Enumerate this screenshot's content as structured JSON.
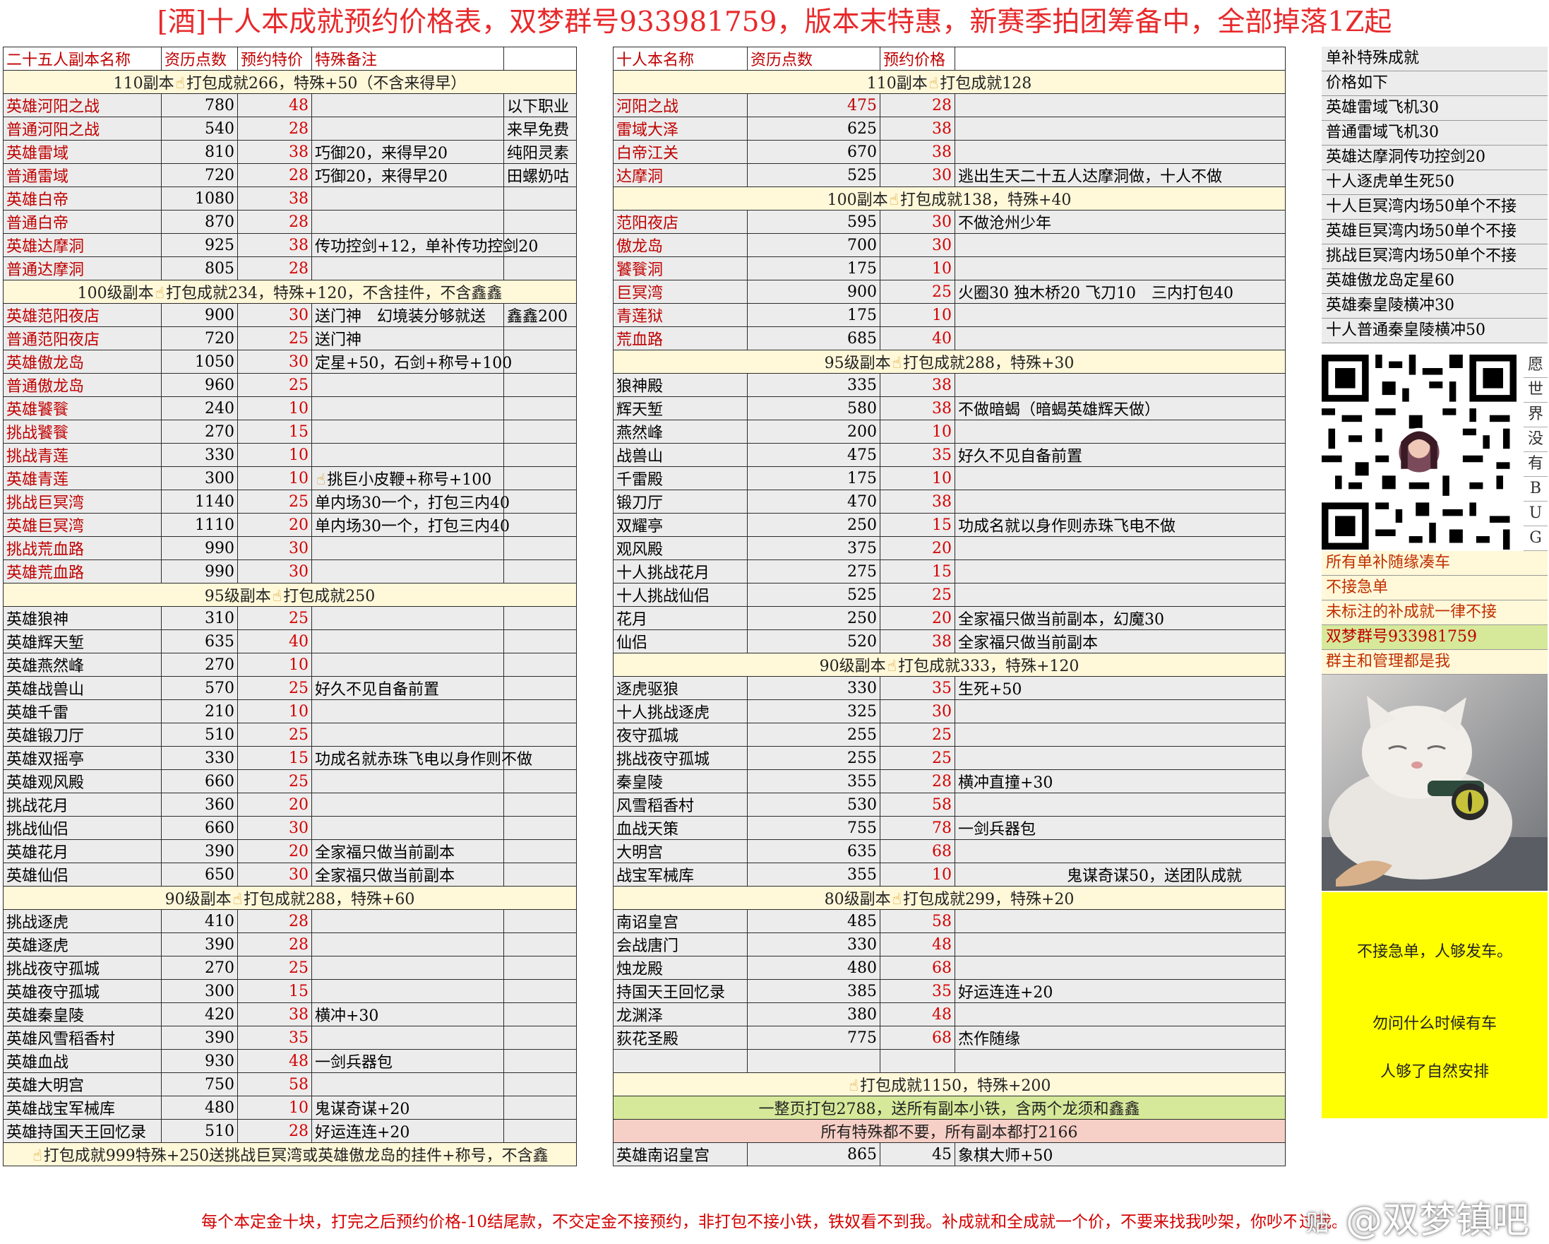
{
  "title": "[酒]十人本成就预约价格表，双梦群号933981759，版本末特惠，新赛季拍团筹备中，全部掉落1Z起",
  "footer": "每个本定金十块，打完之后预约价格-10结尾款，不交定金不接预约，非打包不接小铁，铁奴看不到我。补成就和全成就一个价，不要来找我吵架，你吵不过我。",
  "watermark": "@双梦镇吧",
  "left": {
    "headers": [
      "二十五人副本名称",
      "资历点数",
      "预约特价",
      "特殊备注",
      ""
    ],
    "rows": [
      {
        "type": "sec",
        "text": "110副本👆打包成就266，特殊+50（不含来得早）"
      },
      {
        "name": "英雄河阳之战",
        "pts": "780",
        "price": "48",
        "note": "",
        "extra": "以下职业",
        "red": true
      },
      {
        "name": "普通河阳之战",
        "pts": "540",
        "price": "28",
        "note": "",
        "extra": "来早免费",
        "red": true
      },
      {
        "name": "英雄雷域",
        "pts": "810",
        "price": "38",
        "note": "巧御20，来得早20",
        "extra": "纯阳灵素",
        "red": true
      },
      {
        "name": "普通雷域",
        "pts": "720",
        "price": "28",
        "note": "巧御20，来得早20",
        "extra": "田螺奶咕",
        "red": true
      },
      {
        "name": "英雄白帝",
        "pts": "1080",
        "price": "38",
        "note": "",
        "extra": "",
        "red": true
      },
      {
        "name": "普通白帝",
        "pts": "870",
        "price": "28",
        "note": "",
        "extra": "",
        "red": true
      },
      {
        "name": "英雄达摩洞",
        "pts": "925",
        "price": "38",
        "note": "传功控剑+12，单补传功控剑20",
        "extra": "",
        "red": true
      },
      {
        "name": "普通达摩洞",
        "pts": "805",
        "price": "28",
        "note": "",
        "extra": "",
        "red": true
      },
      {
        "type": "sec",
        "text": "100级副本👆打包成就234，特殊+120，不含挂件，不含鑫鑫"
      },
      {
        "name": "英雄范阳夜店",
        "pts": "900",
        "price": "30",
        "note": "送门神　幻境装分够就送",
        "extra": "鑫鑫200",
        "red": true
      },
      {
        "name": "普通范阳夜店",
        "pts": "720",
        "price": "25",
        "note": "送门神",
        "extra": "",
        "red": true
      },
      {
        "name": "英雄傲龙岛",
        "pts": "1050",
        "price": "30",
        "note": "定星+50，石剑+称号+100",
        "extra": "",
        "red": true
      },
      {
        "name": "普通傲龙岛",
        "pts": "960",
        "price": "25",
        "note": "",
        "extra": "",
        "red": true
      },
      {
        "name": "英雄饕餮",
        "pts": "240",
        "price": "10",
        "note": "",
        "extra": "",
        "red": true
      },
      {
        "name": "挑战饕餮",
        "pts": "270",
        "price": "15",
        "note": "",
        "extra": "",
        "red": true
      },
      {
        "name": "挑战青莲",
        "pts": "330",
        "price": "10",
        "note": "",
        "extra": "",
        "red": true
      },
      {
        "name": "英雄青莲",
        "pts": "300",
        "price": "10",
        "note": "👆挑巨小皮鞭+称号+100",
        "extra": "",
        "red": true
      },
      {
        "name": "挑战巨冥湾",
        "pts": "1140",
        "price": "25",
        "note": "单内场30一个，打包三内40",
        "extra": "",
        "red": true
      },
      {
        "name": "英雄巨冥湾",
        "pts": "1110",
        "price": "20",
        "note": "单内场30一个，打包三内40",
        "extra": "",
        "red": true
      },
      {
        "name": "挑战荒血路",
        "pts": "990",
        "price": "30",
        "note": "",
        "extra": "",
        "red": true
      },
      {
        "name": "英雄荒血路",
        "pts": "990",
        "price": "30",
        "note": "",
        "extra": "",
        "red": true
      },
      {
        "type": "sec",
        "text": "95级副本👆打包成就250"
      },
      {
        "name": "英雄狼神",
        "pts": "310",
        "price": "25",
        "note": "",
        "extra": ""
      },
      {
        "name": "英雄辉天堑",
        "pts": "635",
        "price": "40",
        "note": "",
        "extra": ""
      },
      {
        "name": "英雄燕然峰",
        "pts": "270",
        "price": "10",
        "note": "",
        "extra": ""
      },
      {
        "name": "英雄战兽山",
        "pts": "570",
        "price": "25",
        "note": "好久不见自备前置",
        "extra": ""
      },
      {
        "name": "英雄千雷",
        "pts": "210",
        "price": "10",
        "note": "",
        "extra": ""
      },
      {
        "name": "英雄锻刀厅",
        "pts": "510",
        "price": "25",
        "note": "",
        "extra": ""
      },
      {
        "name": "英雄双摇亭",
        "pts": "330",
        "price": "15",
        "note": "功成名就赤珠飞电以身作则不做",
        "extra": ""
      },
      {
        "name": "英雄观风殿",
        "pts": "660",
        "price": "25",
        "note": "",
        "extra": ""
      },
      {
        "name": "挑战花月",
        "pts": "360",
        "price": "20",
        "note": "",
        "extra": ""
      },
      {
        "name": "挑战仙侣",
        "pts": "660",
        "price": "30",
        "note": "",
        "extra": ""
      },
      {
        "name": "英雄花月",
        "pts": "390",
        "price": "20",
        "note": "全家福只做当前副本",
        "extra": ""
      },
      {
        "name": "英雄仙侣",
        "pts": "650",
        "price": "30",
        "note": "全家福只做当前副本",
        "extra": ""
      },
      {
        "type": "sec",
        "text": "90级副本👆打包成就288，特殊+60"
      },
      {
        "name": "挑战逐虎",
        "pts": "410",
        "price": "28",
        "note": "",
        "extra": ""
      },
      {
        "name": "英雄逐虎",
        "pts": "390",
        "price": "28",
        "note": "",
        "extra": ""
      },
      {
        "name": "挑战夜守孤城",
        "pts": "270",
        "price": "25",
        "note": "",
        "extra": ""
      },
      {
        "name": "英雄夜守孤城",
        "pts": "300",
        "price": "15",
        "note": "",
        "extra": ""
      },
      {
        "name": "英雄秦皇陵",
        "pts": "420",
        "price": "38",
        "note": "横冲+30",
        "extra": ""
      },
      {
        "name": "英雄风雪稻香村",
        "pts": "390",
        "price": "35",
        "note": "",
        "extra": ""
      },
      {
        "name": "英雄血战",
        "pts": "930",
        "price": "48",
        "note": "一剑兵器包",
        "extra": ""
      },
      {
        "name": "英雄大明宫",
        "pts": "750",
        "price": "58",
        "note": "",
        "extra": ""
      },
      {
        "name": "英雄战宝军械库",
        "pts": "480",
        "price": "10",
        "note": "鬼谋奇谋+20",
        "extra": ""
      },
      {
        "name": "英雄持国天王回忆录",
        "pts": "510",
        "price": "28",
        "note": "好运连连+20",
        "extra": ""
      },
      {
        "type": "sec",
        "text": "👆打包成就999特殊+250送挑战巨冥湾或英雄傲龙岛的挂件+称号，不含鑫"
      }
    ]
  },
  "middle": {
    "headers": [
      "十人本名称",
      "资历点数",
      "预约价格",
      "",
      ""
    ],
    "rows": [
      {
        "type": "sec",
        "text": "110副本👆打包成就128"
      },
      {
        "name": "河阳之战",
        "pts": "475",
        "price": "28",
        "note": "",
        "red": true,
        "redpts": true
      },
      {
        "name": "雷域大泽",
        "pts": "625",
        "price": "38",
        "note": "",
        "red": true
      },
      {
        "name": "白帝江关",
        "pts": "670",
        "price": "38",
        "note": "",
        "red": true
      },
      {
        "name": "达摩洞",
        "pts": "525",
        "price": "30",
        "note": "逃出生天二十五人达摩洞做，十人不做",
        "red": true
      },
      {
        "type": "sec",
        "text": "100副本👆打包成就138，特殊+40"
      },
      {
        "name": "范阳夜店",
        "pts": "595",
        "price": "30",
        "note": "不做沧州少年",
        "red": true
      },
      {
        "name": "傲龙岛",
        "pts": "700",
        "price": "30",
        "note": "",
        "red": true
      },
      {
        "name": "饕餮洞",
        "pts": "175",
        "price": "10",
        "note": "",
        "red": true
      },
      {
        "name": "巨冥湾",
        "pts": "900",
        "price": "25",
        "note": "火圈30 独木桥20 飞刀10　三内打包40",
        "red": true
      },
      {
        "name": "青莲狱",
        "pts": "175",
        "price": "10",
        "note": "",
        "red": true
      },
      {
        "name": "荒血路",
        "pts": "685",
        "price": "40",
        "note": "",
        "red": true
      },
      {
        "type": "sec",
        "text": "95级副本👆打包成就288，特殊+30"
      },
      {
        "name": "狼神殿",
        "pts": "335",
        "price": "38",
        "note": ""
      },
      {
        "name": "辉天堑",
        "pts": "580",
        "price": "38",
        "note": "不做暗蝎（暗蝎英雄辉天做）"
      },
      {
        "name": "燕然峰",
        "pts": "200",
        "price": "10",
        "note": ""
      },
      {
        "name": "战兽山",
        "pts": "475",
        "price": "35",
        "note": "好久不见自备前置"
      },
      {
        "name": "千雷殿",
        "pts": "175",
        "price": "10",
        "note": ""
      },
      {
        "name": "锻刀厅",
        "pts": "470",
        "price": "38",
        "note": ""
      },
      {
        "name": "双耀亭",
        "pts": "250",
        "price": "15",
        "note": "功成名就以身作则赤珠飞电不做"
      },
      {
        "name": "观风殿",
        "pts": "375",
        "price": "20",
        "note": ""
      },
      {
        "name": "十人挑战花月",
        "pts": "275",
        "price": "15",
        "note": ""
      },
      {
        "name": "十人挑战仙侣",
        "pts": "525",
        "price": "25",
        "note": ""
      },
      {
        "name": "花月",
        "pts": "250",
        "price": "20",
        "note": "全家福只做当前副本，幻魔30"
      },
      {
        "name": "仙侣",
        "pts": "520",
        "price": "38",
        "note": "全家福只做当前副本"
      },
      {
        "type": "sec",
        "text": "90级副本👆打包成就333，特殊+120"
      },
      {
        "name": "逐虎驱狼",
        "pts": "330",
        "price": "35",
        "note": "生死+50"
      },
      {
        "name": "十人挑战逐虎",
        "pts": "325",
        "price": "30",
        "note": ""
      },
      {
        "name": "夜守孤城",
        "pts": "255",
        "price": "25",
        "note": ""
      },
      {
        "name": "挑战夜守孤城",
        "pts": "255",
        "price": "25",
        "note": ""
      },
      {
        "name": "秦皇陵",
        "pts": "355",
        "price": "28",
        "note": "横冲直撞+30"
      },
      {
        "name": "风雪稻香村",
        "pts": "530",
        "price": "58",
        "note": ""
      },
      {
        "name": "血战天策",
        "pts": "755",
        "price": "78",
        "note": "一剑兵器包"
      },
      {
        "name": "大明宫",
        "pts": "635",
        "price": "68",
        "note": ""
      },
      {
        "name": "战宝军械库",
        "pts": "355",
        "price": "10",
        "note": "　　　　　　　鬼谋奇谋50，送团队成就"
      },
      {
        "type": "sec",
        "text": "80级副本👆打包成就299，特殊+20"
      },
      {
        "name": "南诏皇宫",
        "pts": "485",
        "price": "58",
        "note": ""
      },
      {
        "name": "会战唐门",
        "pts": "330",
        "price": "48",
        "note": ""
      },
      {
        "name": "烛龙殿",
        "pts": "480",
        "price": "68",
        "note": ""
      },
      {
        "name": "持国天王回忆录",
        "pts": "385",
        "price": "35",
        "note": "好运连连+20"
      },
      {
        "name": "龙渊泽",
        "pts": "380",
        "price": "48",
        "note": ""
      },
      {
        "name": "荻花圣殿",
        "pts": "775",
        "price": "68",
        "note": "杰作随缘"
      },
      {
        "name": "",
        "pts": "",
        "price": "",
        "note": ""
      },
      {
        "type": "sec",
        "text": "👆打包成就1150，特殊+200"
      },
      {
        "type": "green",
        "text": "一整页打包2788，送所有副本小铁，含两个龙须和鑫鑫"
      },
      {
        "type": "pink",
        "text": "所有特殊都不要，所有副本都打2166"
      },
      {
        "name": "英雄南诏皇宫",
        "pts": "865",
        "price": "45",
        "note": "象棋大师+50",
        "blackprice": true
      }
    ]
  },
  "right": {
    "items": [
      "单补特殊成就",
      "价格如下",
      "英雄雷域飞机30",
      "普通雷域飞机30",
      "英雄达摩洞传功控剑20",
      "十人逐虎单生死50",
      "十人巨冥湾内场50单个不接",
      "英雄巨冥湾内场50单个不接",
      "挑战巨冥湾内场50单个不接",
      "英雄傲龙岛定星60",
      "英雄秦皇陵横冲30",
      "十人普通秦皇陵横冲50"
    ],
    "qr_side": [
      "愿",
      "世",
      "界",
      "没",
      "有",
      "B",
      "U",
      "G"
    ],
    "notes": [
      "所有单补随缘凑车",
      "不接急单",
      "未标注的补成就一律不接",
      "双梦群号933981759",
      "群主和管理都是我"
    ],
    "yellow_box": [
      "不接急单，人够发车。",
      "勿问什么时候有车",
      "人够了自然安排"
    ]
  }
}
